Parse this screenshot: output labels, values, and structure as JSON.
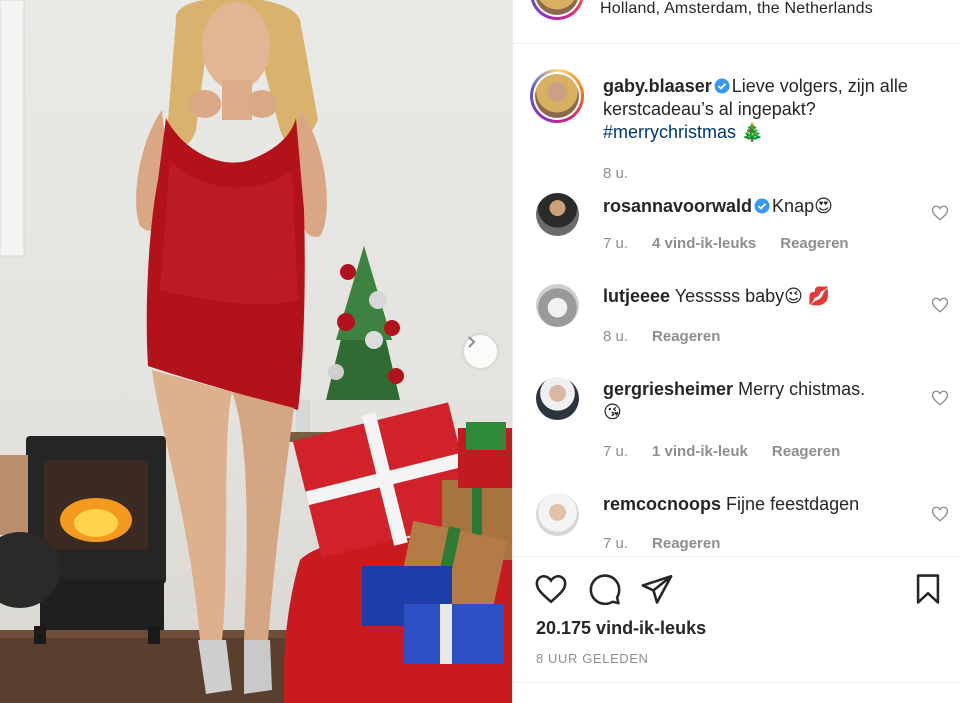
{
  "post": {
    "location": "Holland, Amsterdam, the Netherlands",
    "caption": {
      "username": "gaby.blaaser",
      "text": "Lieve volgers, zijn alle kerstcadeau’s al ingepakt?",
      "hashtag": "#merrychristmas",
      "emoji": "🎄",
      "time": "8 u."
    }
  },
  "comments": [
    {
      "username": "rosannavoorwald",
      "verified": true,
      "text": "Knap😍",
      "time": "7 u.",
      "likes": "4 vind-ik-leuks",
      "reply": "Reageren"
    },
    {
      "username": "lutjeeee",
      "verified": false,
      "text": "Yesssss baby😉 💋",
      "time": "8 u.",
      "likes": "",
      "reply": "Reageren"
    },
    {
      "username": "gergriesheimer",
      "verified": false,
      "text": "Merry chistmas.",
      "text2": "😘",
      "time": "7 u.",
      "likes": "1 vind-ik-leuk",
      "reply": "Reageren"
    },
    {
      "username": "remcocnoops",
      "verified": false,
      "text": "Fijne feestdagen",
      "time": "7 u.",
      "likes": "",
      "reply": "Reageren"
    }
  ],
  "actions": {
    "icons": [
      "heart-icon",
      "comment-icon",
      "share-icon",
      "bookmark-icon"
    ],
    "likes_count": "20.175 vind-ik-leuks",
    "posted_ago": "8 UUR GELEDEN"
  },
  "colors": {
    "hashtag": "#00376b",
    "verified": "#3897f0",
    "muted": "#8e8e8e",
    "dress": "#b3121b"
  }
}
